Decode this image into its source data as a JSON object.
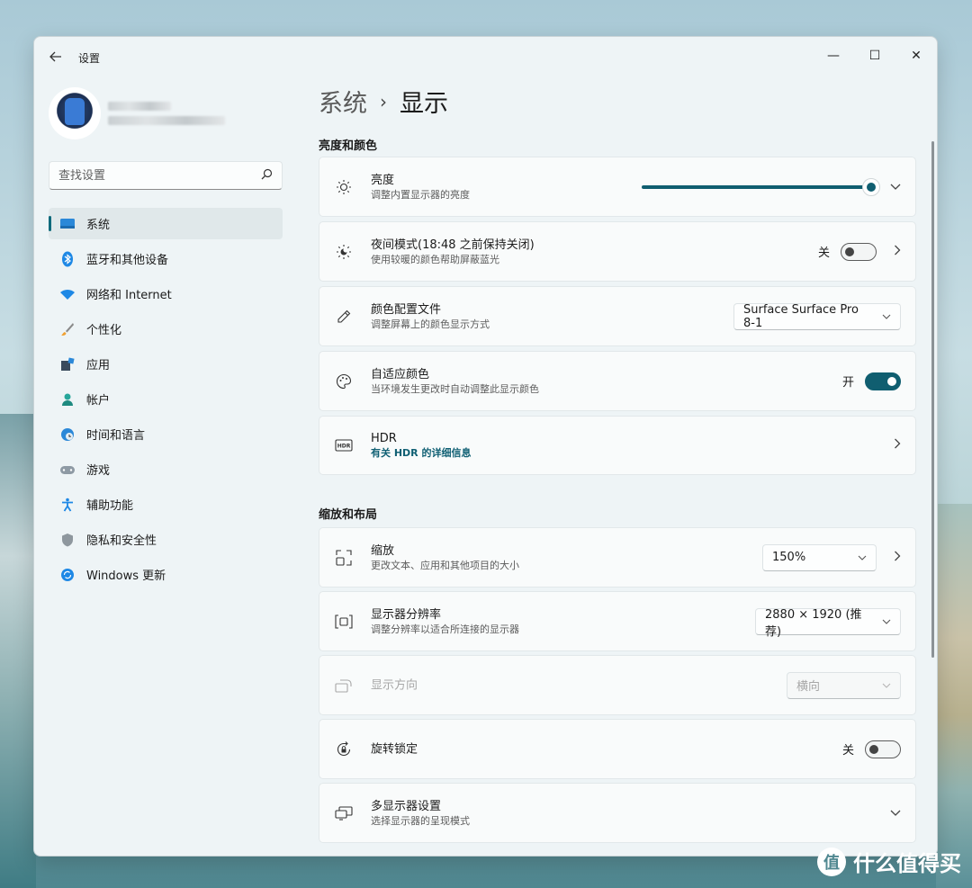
{
  "window": {
    "app_title": "设置",
    "controls": {
      "minimize": "—",
      "maximize": "☐",
      "close": "✕"
    }
  },
  "search": {
    "placeholder": "查找设置"
  },
  "nav": {
    "items": [
      {
        "label": "系统",
        "icon": "display-icon",
        "active": true
      },
      {
        "label": "蓝牙和其他设备",
        "icon": "bluetooth-icon"
      },
      {
        "label": "网络和 Internet",
        "icon": "wifi-icon"
      },
      {
        "label": "个性化",
        "icon": "brush-icon"
      },
      {
        "label": "应用",
        "icon": "apps-icon"
      },
      {
        "label": "帐户",
        "icon": "person-icon"
      },
      {
        "label": "时间和语言",
        "icon": "globe-clock-icon"
      },
      {
        "label": "游戏",
        "icon": "gamepad-icon"
      },
      {
        "label": "辅助功能",
        "icon": "accessibility-icon"
      },
      {
        "label": "隐私和安全性",
        "icon": "shield-icon"
      },
      {
        "label": "Windows 更新",
        "icon": "update-icon"
      }
    ]
  },
  "breadcrumb": {
    "parent": "系统",
    "separator": "›",
    "current": "显示"
  },
  "sections": {
    "brightness_color": "亮度和颜色",
    "scale_layout": "缩放和布局"
  },
  "cards": {
    "brightness": {
      "title": "亮度",
      "subtitle": "调整内置显示器的亮度",
      "value": 1.0
    },
    "night_light": {
      "title": "夜间模式(18:48 之前保持关闭)",
      "subtitle": "使用较暖的颜色帮助屏蔽蓝光",
      "toggle_label": "关",
      "state": false
    },
    "color_profile": {
      "title": "颜色配置文件",
      "subtitle": "调整屏幕上的颜色显示方式",
      "selected": "Surface Surface Pro 8-1"
    },
    "adaptive_color": {
      "title": "自适应颜色",
      "subtitle": "当环境发生更改时自动调整此显示颜色",
      "toggle_label": "开",
      "state": true
    },
    "hdr": {
      "title": "HDR",
      "subtitle": "有关 HDR 的详细信息"
    },
    "scale": {
      "title": "缩放",
      "subtitle": "更改文本、应用和其他项目的大小",
      "selected": "150%"
    },
    "resolution": {
      "title": "显示器分辨率",
      "subtitle": "调整分辨率以适合所连接的显示器",
      "selected": "2880 × 1920 (推荐)"
    },
    "orientation": {
      "title": "显示方向",
      "selected": "横向",
      "disabled": true
    },
    "rotation_lock": {
      "title": "旋转锁定",
      "toggle_label": "关",
      "state": false
    },
    "multi_display": {
      "title": "多显示器设置",
      "subtitle": "选择显示器的呈现模式"
    }
  },
  "watermark": {
    "text": "什么值得买",
    "logo": "值"
  },
  "colors": {
    "accent": "#105e70",
    "window_bg": "#eef4f6",
    "card_bg": "#f9fbfb"
  }
}
